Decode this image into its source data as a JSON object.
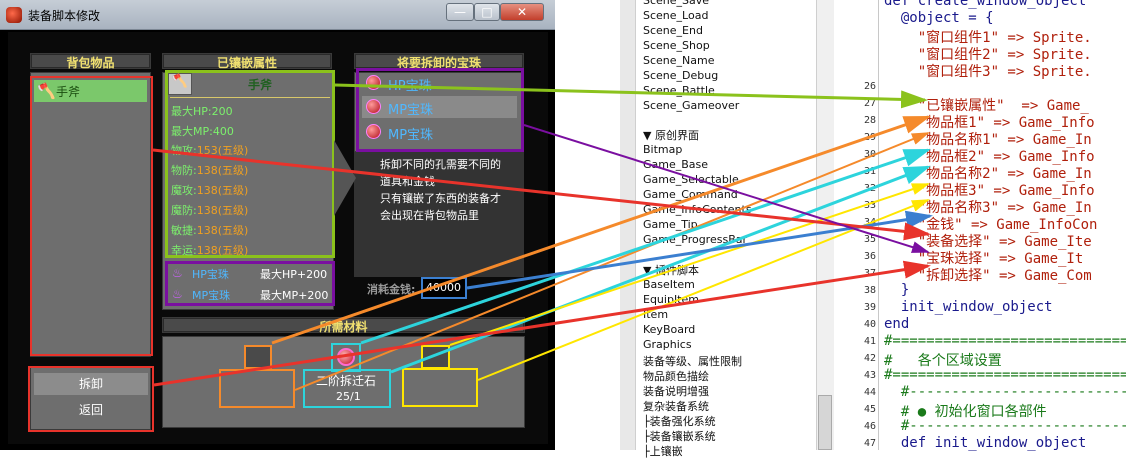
{
  "window": {
    "title": "装备脚本修改"
  },
  "panels": {
    "bag": {
      "title": "背包物品",
      "items": [
        {
          "name": "手斧"
        }
      ]
    },
    "embedded": {
      "title": "已镶嵌属性",
      "item": "手斧",
      "stats": [
        {
          "label": "最大HP:",
          "value": "200",
          "extra": ""
        },
        {
          "label": "最大MP:",
          "value": "400",
          "extra": ""
        },
        {
          "label": "物攻:",
          "value": "153",
          "extra": "(五级)"
        },
        {
          "label": "物防:",
          "value": "138",
          "extra": "(五级)"
        },
        {
          "label": "魔攻:",
          "value": "138",
          "extra": "(五级)"
        },
        {
          "label": "魔防:",
          "value": "138",
          "extra": "(五级)"
        },
        {
          "label": "敏捷:",
          "value": "138",
          "extra": "(五级)"
        },
        {
          "label": "幸运:",
          "value": "138",
          "extra": "(五级)"
        }
      ],
      "gems": [
        {
          "name": "HP宝珠",
          "effect": "最大HP+200"
        },
        {
          "name": "MP宝珠",
          "effect": "最大MP+200"
        }
      ]
    },
    "remove": {
      "title": "将要拆卸的宝珠",
      "gems": [
        "HP宝珠",
        "MP宝珠",
        "MP宝珠"
      ]
    },
    "materials": {
      "title": "所需材料",
      "item_name": "二阶拆迁石",
      "item_count": "25/1"
    }
  },
  "info_text": [
    "拆卸不同的孔需要不同的",
    "道具和金钱",
    "只有镶嵌了东西的装备才",
    "会出现在背包物品里"
  ],
  "cost": {
    "label": "消耗金钱:",
    "value": "40000"
  },
  "commands": [
    "拆卸",
    "返回"
  ],
  "file_list": {
    "scenes": [
      "Scene_Save",
      "Scene_Load",
      "Scene_End",
      "Scene_Shop",
      "Scene_Name",
      "Scene_Debug",
      "Scene_Battle",
      "Scene_Gameover"
    ],
    "section_original": "▼ 原创界面",
    "original": [
      "Bitmap",
      "Game_Base",
      "Game_Selectable",
      "Game_Command",
      "Game_InfoContents",
      "Game_Tip",
      "Game_ProgressBar"
    ],
    "section_plugins": "▼ 插件脚本",
    "plugins": [
      "BaseItem",
      "EquipItem",
      "Item",
      "KeyBoard",
      "Graphics",
      "装备等级、属性限制",
      "物品颜色描绘",
      "装备说明增强",
      "复杂装备系统",
      "├装备强化系统",
      "├装备镶嵌系统",
      "├上镶嵌"
    ]
  },
  "code": {
    "line_numbers": [
      "",
      "",
      "",
      "",
      "",
      "26",
      "27",
      "28",
      "29",
      "30",
      "31",
      "32",
      "33",
      "34",
      "35",
      "36",
      "37",
      "38",
      "39",
      "40",
      "41",
      "42",
      "43",
      "44",
      "45",
      "46",
      "47"
    ],
    "lines": [
      "def create_window_object",
      "  @object = {",
      "    \"窗口组件1\" => Sprite.",
      "    \"窗口组件2\" => Sprite.",
      "    \"窗口组件3\" => Sprite.",
      "",
      "    \"已镶嵌属性\"  => Game_",
      "    \"物品框1\" => Game_Info",
      "    \"物品名称1\" => Game_In",
      "    \"物品框2\" => Game_Info",
      "    \"物品名称2\" => Game_In",
      "    \"物品框3\" => Game_Info",
      "    \"物品名称3\" => Game_In",
      "    \"金钱\" => Game_InfoCon",
      "    \"装备选择\" => Game_Ite",
      "    \"宝珠选择\" => Game_It",
      "    \"拆卸选择\" => Game_Com",
      "  }",
      "  init_window_object",
      "end",
      "#==================================",
      "#   各个区域设置",
      "#==================================",
      "  #--------------------------------",
      "  # ● 初始化窗口各部件",
      "  #--------------------------------",
      "  def init_window_object"
    ]
  },
  "colors": {
    "red": "#e8332b",
    "orange": "#f58a2b",
    "teal": "#2dd4dc",
    "yellow": "#ffe600",
    "olive": "#8bc21c",
    "purple": "#7a0fa0",
    "blue": "#3b7fd0",
    "green_text": "#7cf06c",
    "orange_text": "#f0a020"
  }
}
